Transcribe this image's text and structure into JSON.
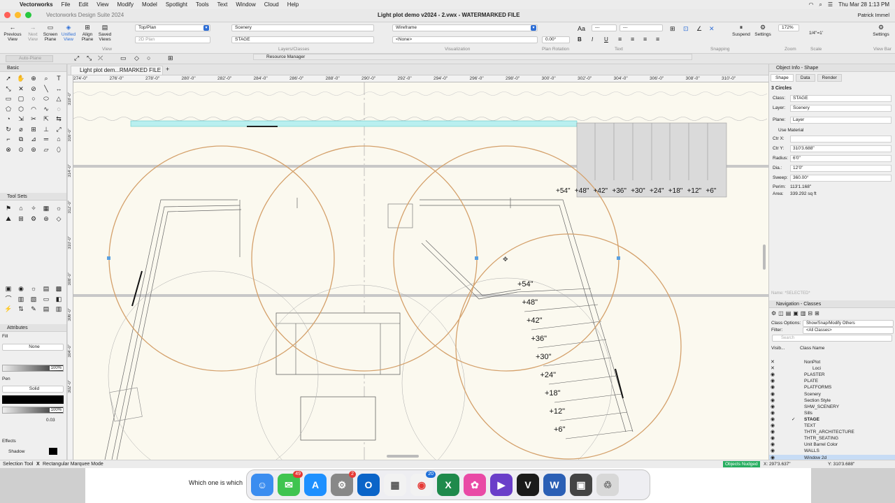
{
  "menubar": {
    "app": "Vectorworks",
    "items": [
      "File",
      "Edit",
      "View",
      "Modify",
      "Model",
      "Spotlight",
      "Tools",
      "Text",
      "Window",
      "Cloud",
      "Help"
    ],
    "clock": "Thu Mar 28  1:13 PM"
  },
  "titlebar": {
    "suite": "Vectorworks Design Suite 2024",
    "document": "Light plot demo v2024 - 2.vwx - WATERMARKED FILE",
    "user": "Patrick Immel"
  },
  "toolbar": {
    "previous_view": "Previous View",
    "next_view": "Next View",
    "screen_plane": "Screen Plane",
    "unified_view": "Unified View",
    "align_plane": "Align Plane",
    "saved_views": "Saved Views",
    "view_value": "Top/Plan",
    "plane_value": "2D Plan",
    "layer_value": "Scenery",
    "class_value": "STAGE",
    "render_value": "Wireframe",
    "light_value": "<None>",
    "rotation_value": "0.00°",
    "font_value": "---",
    "size_value": "---",
    "zoom_value": "172%",
    "scale_value": "1/4\"=1'",
    "suspend": "Suspend",
    "settings": "Settings",
    "settings2": "Settings",
    "group_view": "View",
    "group_layers": "Layers/Classes",
    "group_visual": "Visualization",
    "group_rotation": "Plan Rotation",
    "group_text": "Text",
    "group_snapping": "Snapping",
    "group_zoom": "Zoom",
    "group_scale": "Scale",
    "group_viewbar": "View Bar",
    "auto_plane": "Auto-Plane",
    "resource_manager": "Resource Manager"
  },
  "left_panels": {
    "basic": "Basic",
    "tool_sets": "Tool Sets",
    "attributes": "Attributes",
    "fill_label": "Fill",
    "fill_value": "None",
    "fill_opacity": "100%",
    "pen_label": "Pen",
    "pen_value": "Solid",
    "pen_opacity": "100%",
    "line_weight": "0.03",
    "effects": "Effects",
    "shadow": "Shadow"
  },
  "document": {
    "tab": "Light plot dem...RMARKED FILE",
    "ruler_h": [
      "274'-0\"",
      "276'-0\"",
      "278'-0\"",
      "280'-0\"",
      "282'-0\"",
      "284'-0\"",
      "286'-0\"",
      "288'-0\"",
      "290'-0\"",
      "292'-0\"",
      "294'-0\"",
      "296'-0\"",
      "298'-0\"",
      "300'-0\"",
      "302'-0\"",
      "304'-0\"",
      "306'-0\"",
      "308'-0\"",
      "310'-0\""
    ],
    "ruler_v": [
      "318'-0\"",
      "316'-0\"",
      "314'-0\"",
      "312'-0\"",
      "310'-0\"",
      "308'-0\"",
      "306'-0\"",
      "304'-0\"",
      "302'-0\""
    ],
    "row_labels": [
      "+54\"",
      "+48\"",
      "+42\"",
      "+36\"",
      "+30\"",
      "+24\"",
      "+18\"",
      "+12\"",
      "+6\""
    ],
    "stair_labels": [
      "+54\"",
      "+48\"",
      "+42\"",
      "+36\"",
      "+30\"",
      "+24\"",
      "+18\"",
      "+12\"",
      "+6\""
    ]
  },
  "object_info": {
    "header": "Object Info - Shape",
    "tabs": [
      "Shape",
      "Data",
      "Render"
    ],
    "title": "3 Circles",
    "class_label": "Class:",
    "class_value": "STAGE",
    "layer_label": "Layer:",
    "layer_value": "Scenery",
    "plane_label": "Plane:",
    "plane_value": "Layer",
    "use_material": "Use Material",
    "ctrx_label": "Ctr X:",
    "ctrx_value": "",
    "ctry_label": "Ctr Y:",
    "ctry_value": "310'3.688\"",
    "radius_label": "Radius:",
    "radius_value": "6'0\"",
    "dia_label": "Dia.:",
    "dia_value": "12'0\"",
    "sweep_label": "Sweep:",
    "sweep_value": "360.00°",
    "perim_label": "Perim:",
    "perim_value": "113'1.168\"",
    "area_label": "Area:",
    "area_value": "339.292 sq ft",
    "name_placeholder": "Name: *SELECTED*"
  },
  "navigation": {
    "header": "Navigation - Classes",
    "class_options_label": "Class Options:",
    "class_options_value": "Show/Snap/Modify Others",
    "filter_label": "Filter:",
    "filter_value": "<All Classes>",
    "search_placeholder": "Search",
    "col_visibility": "Visib...",
    "col_name": "Class Name",
    "classes": [
      "NonPlot",
      "Loci",
      "PLASTER",
      "PLATE",
      "PLATFORMS",
      "Scenery",
      "Section Style",
      "SHW_SCENERY",
      "Sills",
      "STAGE",
      "TEXT",
      "THTR_ARCHITECTURE",
      "THTR_SEATING",
      "Unit Barrel Color",
      "WALLS",
      "Window 2d"
    ]
  },
  "status": {
    "tool": "Selection Tool",
    "mode": "Rectangular Marquee Mode",
    "nudged": "Objects Nudged",
    "x": "X: 297'3.637\"",
    "y": "Y: 310'3.688\""
  },
  "desktop": {
    "text": "Which one is which"
  },
  "dock": {
    "messages_badge": "49",
    "settings_badge": "2",
    "chrome_badge": "20"
  },
  "colors": {
    "circle": "#d4a06a",
    "accent": "#2f6fd6",
    "nudged": "#27ae60"
  }
}
